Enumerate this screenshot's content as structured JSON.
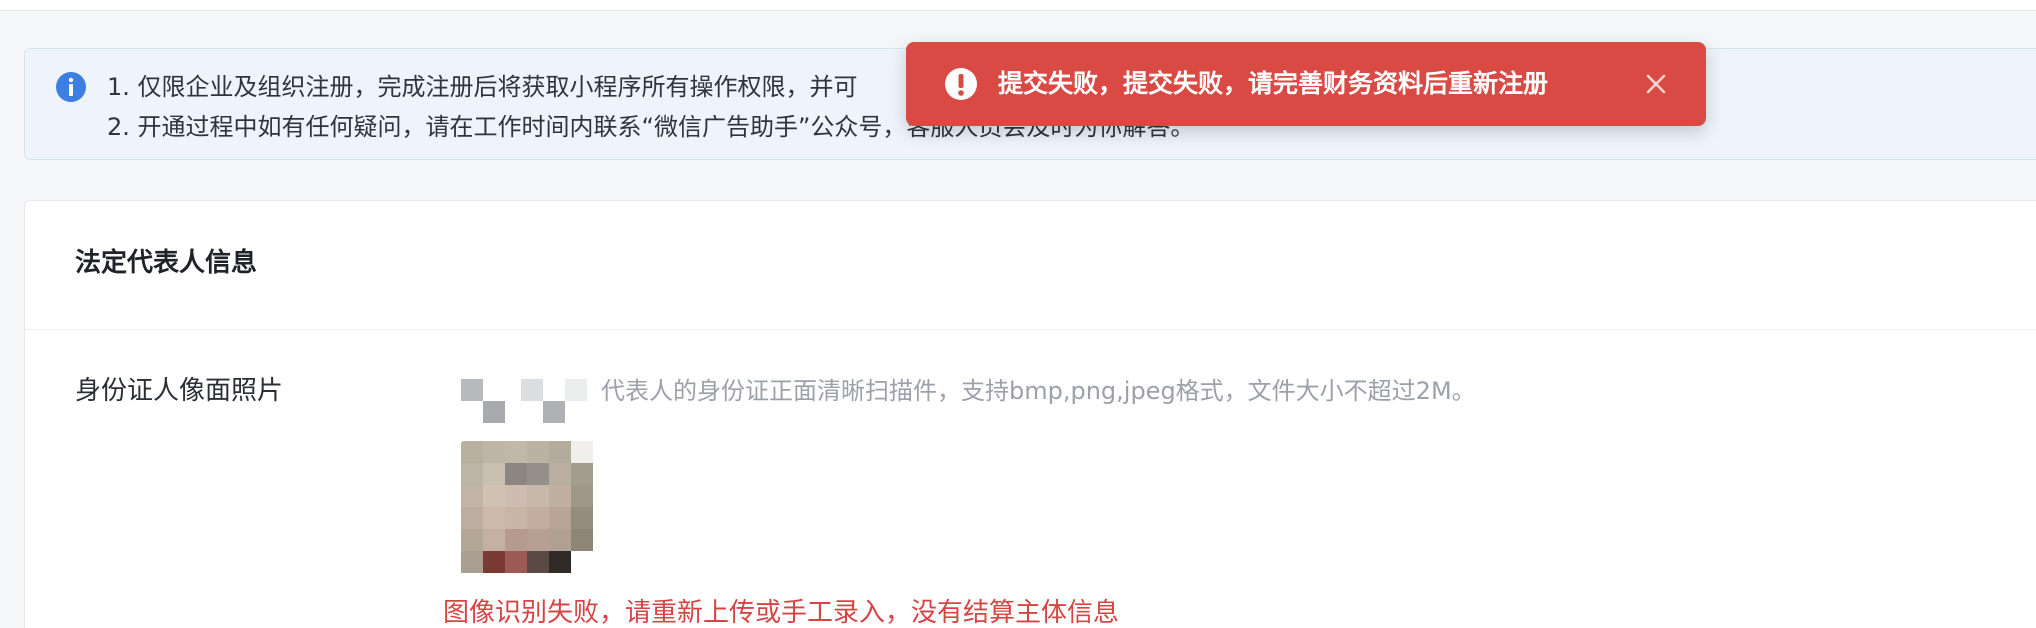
{
  "notice": {
    "icon": "info-icon",
    "line1": "1. 仅限企业及组织注册，完成注册后将获取小程序所有操作权限，并可",
    "line2": "2. 开通过程中如有任何疑问，请在工作时间内联系“微信广告助手”公众号，客服人员会及时为你解答。"
  },
  "toast": {
    "type": "error",
    "icon": "exclamation-circle-icon",
    "message": "提交失败，提交失败，请完善财务资料后重新注册",
    "close_icon": "close-icon",
    "color": "#d94a44"
  },
  "section": {
    "title": "法定代表人信息"
  },
  "field": {
    "label": "身份证人像面照片",
    "hint": "代表人的身份证正面清晰扫描件，支持bmp,png,jpeg格式，文件大小不超过2M。",
    "error": "图像识别失败，请重新上传或手工录入，没有结算主体信息"
  },
  "colors": {
    "error": "#d64545",
    "info": "#3d7fe0",
    "notice_bg": "#eef3fc"
  }
}
